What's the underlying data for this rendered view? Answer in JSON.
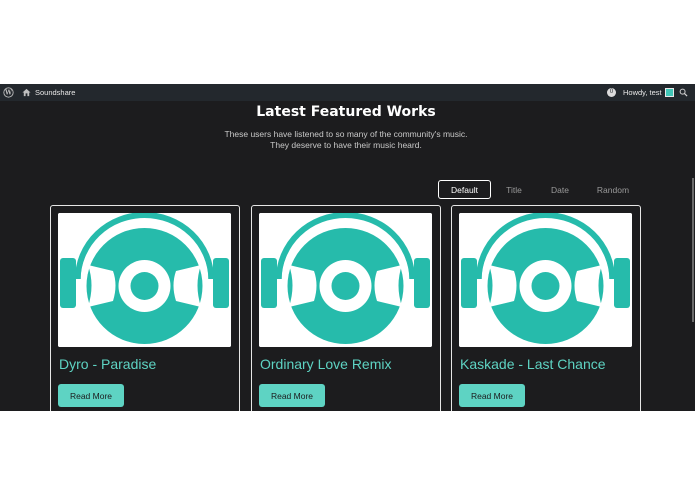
{
  "adminbar": {
    "site_name": "Soundshare",
    "notifications_count": "0",
    "greeting": "Howdy, test"
  },
  "main": {
    "title": "Latest Featured Works",
    "subtitle_line1": "These users have listened to so many of the community's music.",
    "subtitle_line2": "They deserve to have their music heard."
  },
  "sort": {
    "options": [
      "Default",
      "Title",
      "Date",
      "Random"
    ],
    "selected": "Default"
  },
  "cards": [
    {
      "title": "Dyro - Paradise",
      "button": "Read More"
    },
    {
      "title": "Ordinary Love Remix",
      "button": "Read More"
    },
    {
      "title": "Kaskade - Last Chance",
      "button": "Read More"
    }
  ],
  "colors": {
    "background": "#1c1c1e",
    "accent": "#5ed3c3",
    "adminbar": "#23282d"
  },
  "icons": [
    "wordpress-logo-icon",
    "home-icon",
    "search-icon",
    "headphones-disc-icon"
  ]
}
